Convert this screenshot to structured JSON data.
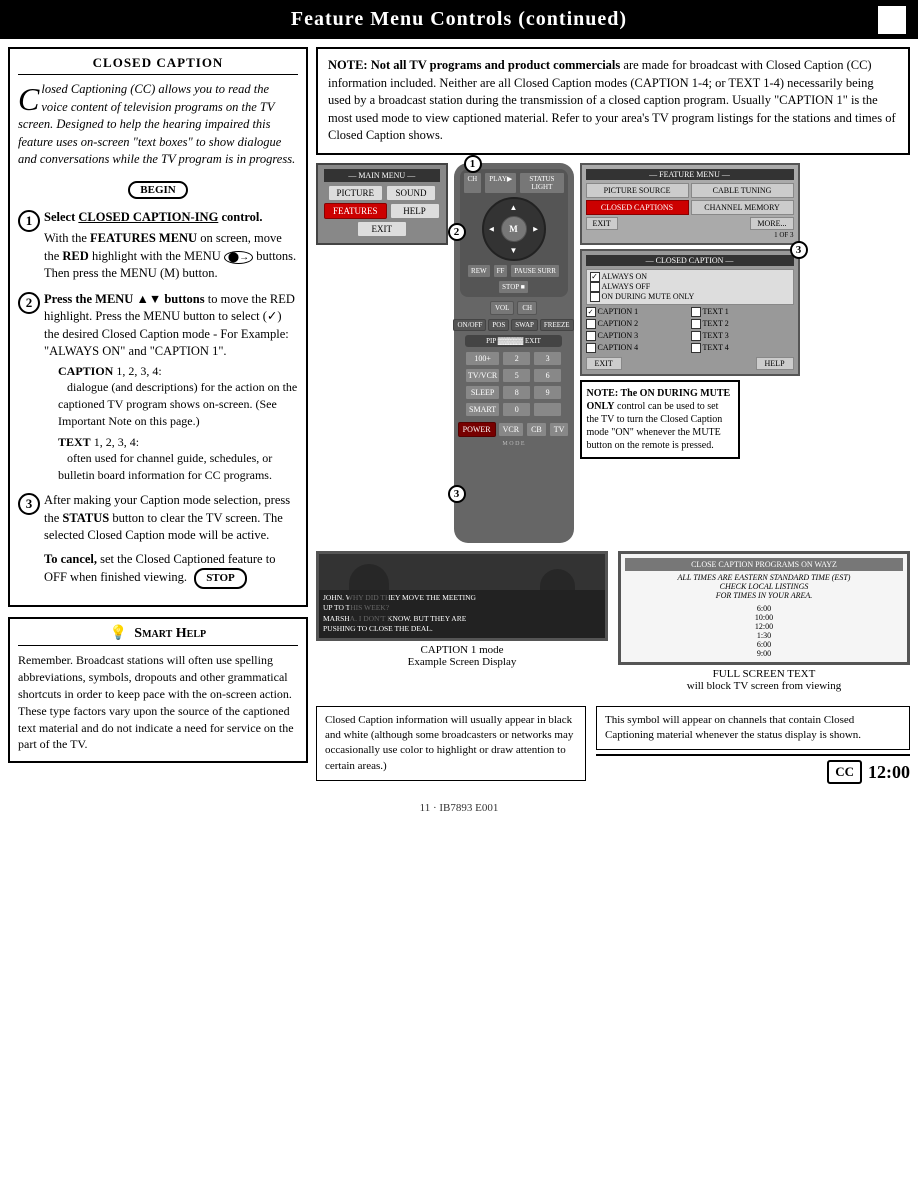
{
  "header": {
    "title": "Feature Menu Controls (continued)",
    "box": ""
  },
  "left_col": {
    "closed_caption_title": "CLOSED CAPTION",
    "intro_dropcap": "C",
    "intro_text": "losed Captioning (CC) allows you to read the voice content of television programs on the TV screen. Designed to help the hearing impaired this feature uses on-screen \"text boxes\" to show dialogue and conversations while the TV program is in progress.",
    "begin_label": "BEGIN",
    "step1_num": "1",
    "step1_text": "Select CLOSED CAPTION-ING control.",
    "step1_sub": "With the FEATURES MENU on screen, move the RED highlight with the MENU",
    "step1_sub2": "buttons. Then press the MENU (M) button.",
    "step2_num": "2",
    "step2_bold": "Press the MENU ▲▼ buttons",
    "step2_text": "to move the RED highlight. Press the MENU button to select (✓) the desired Closed Caption mode - For Example: \"ALWAYS ON\" and \"CAPTION 1\".",
    "caption_label": "CAPTION",
    "caption_nums": "1, 2, 3, 4:",
    "caption_desc": "dialogue (and descriptions) for the action on the captioned TV program shows on-screen. (See Important Note on this page.)",
    "text_label": "TEXT",
    "text_nums": "1, 2, 3, 4:",
    "text_desc": "often used for channel guide, schedules, or bulletin board information for CC programs.",
    "step3_num": "3",
    "step3_text": "After making your Caption mode selection, press the STATUS button to clear the TV screen. The selected Closed Caption mode will be active.",
    "cancel_text": "To cancel, set the Closed Captioned feature to OFF when finished viewing.",
    "stop_label": "STOP",
    "smart_help_title": "Smart Help",
    "smart_help_text": "Remember. Broadcast stations will often use spelling abbreviations, symbols, dropouts and other grammatical shortcuts in order to keep pace with the on-screen action. These type factors vary upon the source of the captioned text material and do not indicate a need for service on the part of the TV."
  },
  "right_col": {
    "note_text": "NOTE: Not all TV programs and product commercials are made for broadcast with Closed Caption (CC) information included. Neither are all Closed Caption modes (CAPTION 1-4; or TEXT 1-4) necessarily being used by a broadcast station during the transmission of a closed caption program. Usually \"CAPTION 1\" is the most used mode to view captioned material. Refer to your area's TV program listings for the stations and times of Closed Caption shows.",
    "main_menu_label": "MAIN MENU",
    "menu_btns": [
      "PICTURE",
      "SOUND",
      "FEATURES",
      "HELP",
      "EXIT"
    ],
    "feature_menu_label": "FEATURE MENU",
    "feature_items": [
      "PICTURE SOURCE",
      "CABLE TUNING",
      "CLOSED CAPTIONS",
      "CHANNEL MEMORY",
      "EXIT",
      "MORE...",
      "1 OF 3"
    ],
    "cc_menu_label": "CLOSED CAPTION",
    "always_on": "ALWAYS ON",
    "always_off": "ALWAYS OFF",
    "on_during_mute": "ON DURING MUTE ONLY",
    "caption_options": [
      "CAPTION 1",
      "CAPTION 2",
      "CAPTION 3",
      "CAPTION 4",
      "TEXT 1",
      "TEXT 2",
      "TEXT 3",
      "TEXT 4"
    ],
    "mute_note": "NOTE: The ON DURING MUTE ONLY control can be used to set the TV to turn the Closed Caption mode \"ON\" whenever the MUTE button on the remote is pressed.",
    "caption1_label": "CAPTION 1 mode",
    "caption1_sub": "Example Screen Display",
    "caption_dialogue": "JOHN. WHY DID THEY MOVE THE MEETING UP TO THIS WEEK? MARSHA. I DON'T KNOW. BUT THEY ARE PUSHING TO CLOSE THE DEAL.",
    "full_screen_title": "CLOSE CAPTION PROGRAMS ON WAYZ",
    "full_screen_sub": "ALL TIMES ARE EASTERN STANDARD TIME (EST) CHECK LOCAL LISTINGS FOR TIMES IN YOUR AREA.",
    "full_screen_times": [
      "6:00",
      "10:00",
      "12:00",
      "1:30",
      "6:00",
      "9:00"
    ],
    "full_screen_label": "FULL SCREEN TEXT",
    "full_screen_sub_label": "will block TV screen from viewing",
    "cc_info_text": "Closed Caption information will usually appear in black and white (although some broadcasters or networks may occasionally use color to highlight or draw attention to certain areas.)",
    "cc_symbol_text": "This symbol will appear on channels that contain Closed Captioning material whenever the status display is shown.",
    "cc_badge": "CC",
    "cc_time": "12:00",
    "step_badges": [
      "1",
      "2",
      "3"
    ]
  },
  "footer": {
    "text": "11 · IB7893 E001"
  }
}
